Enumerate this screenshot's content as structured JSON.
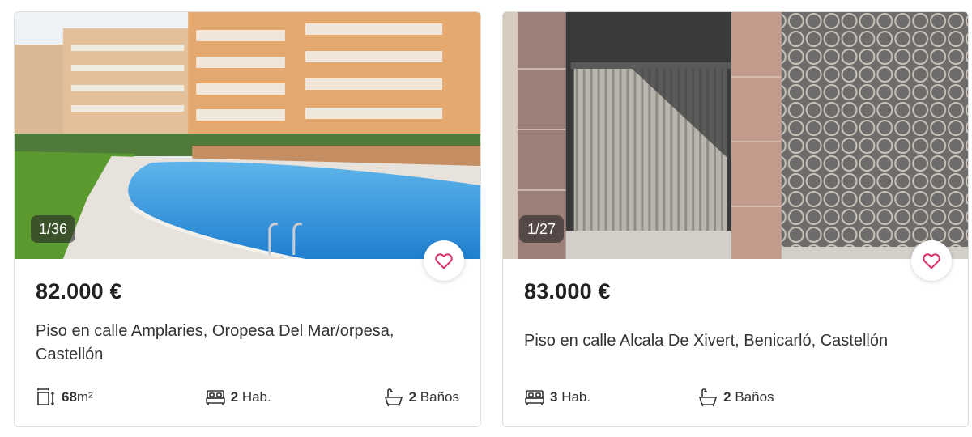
{
  "listings": [
    {
      "photo_counter": "1/36",
      "price": "82.000 €",
      "title": "Piso en calle Amplaries, Oropesa Del Mar/orpesa, Castellón",
      "area_value": "68",
      "area_unit": "m²",
      "rooms_value": "2",
      "rooms_label": "Hab.",
      "baths_value": "2",
      "baths_label": "Baños",
      "favorite_icon": "heart-outline-icon"
    },
    {
      "photo_counter": "1/27",
      "price": "83.000 €",
      "title": "Piso en calle Alcala De Xivert, Benicarló, Castellón",
      "rooms_value": "3",
      "rooms_label": "Hab.",
      "baths_value": "2",
      "baths_label": "Baños",
      "favorite_icon": "heart-outline-icon"
    }
  ],
  "colors": {
    "favorite_accent": "#d6336c",
    "counter_bg": "#3a3a3a",
    "border": "#dcdcdc"
  }
}
